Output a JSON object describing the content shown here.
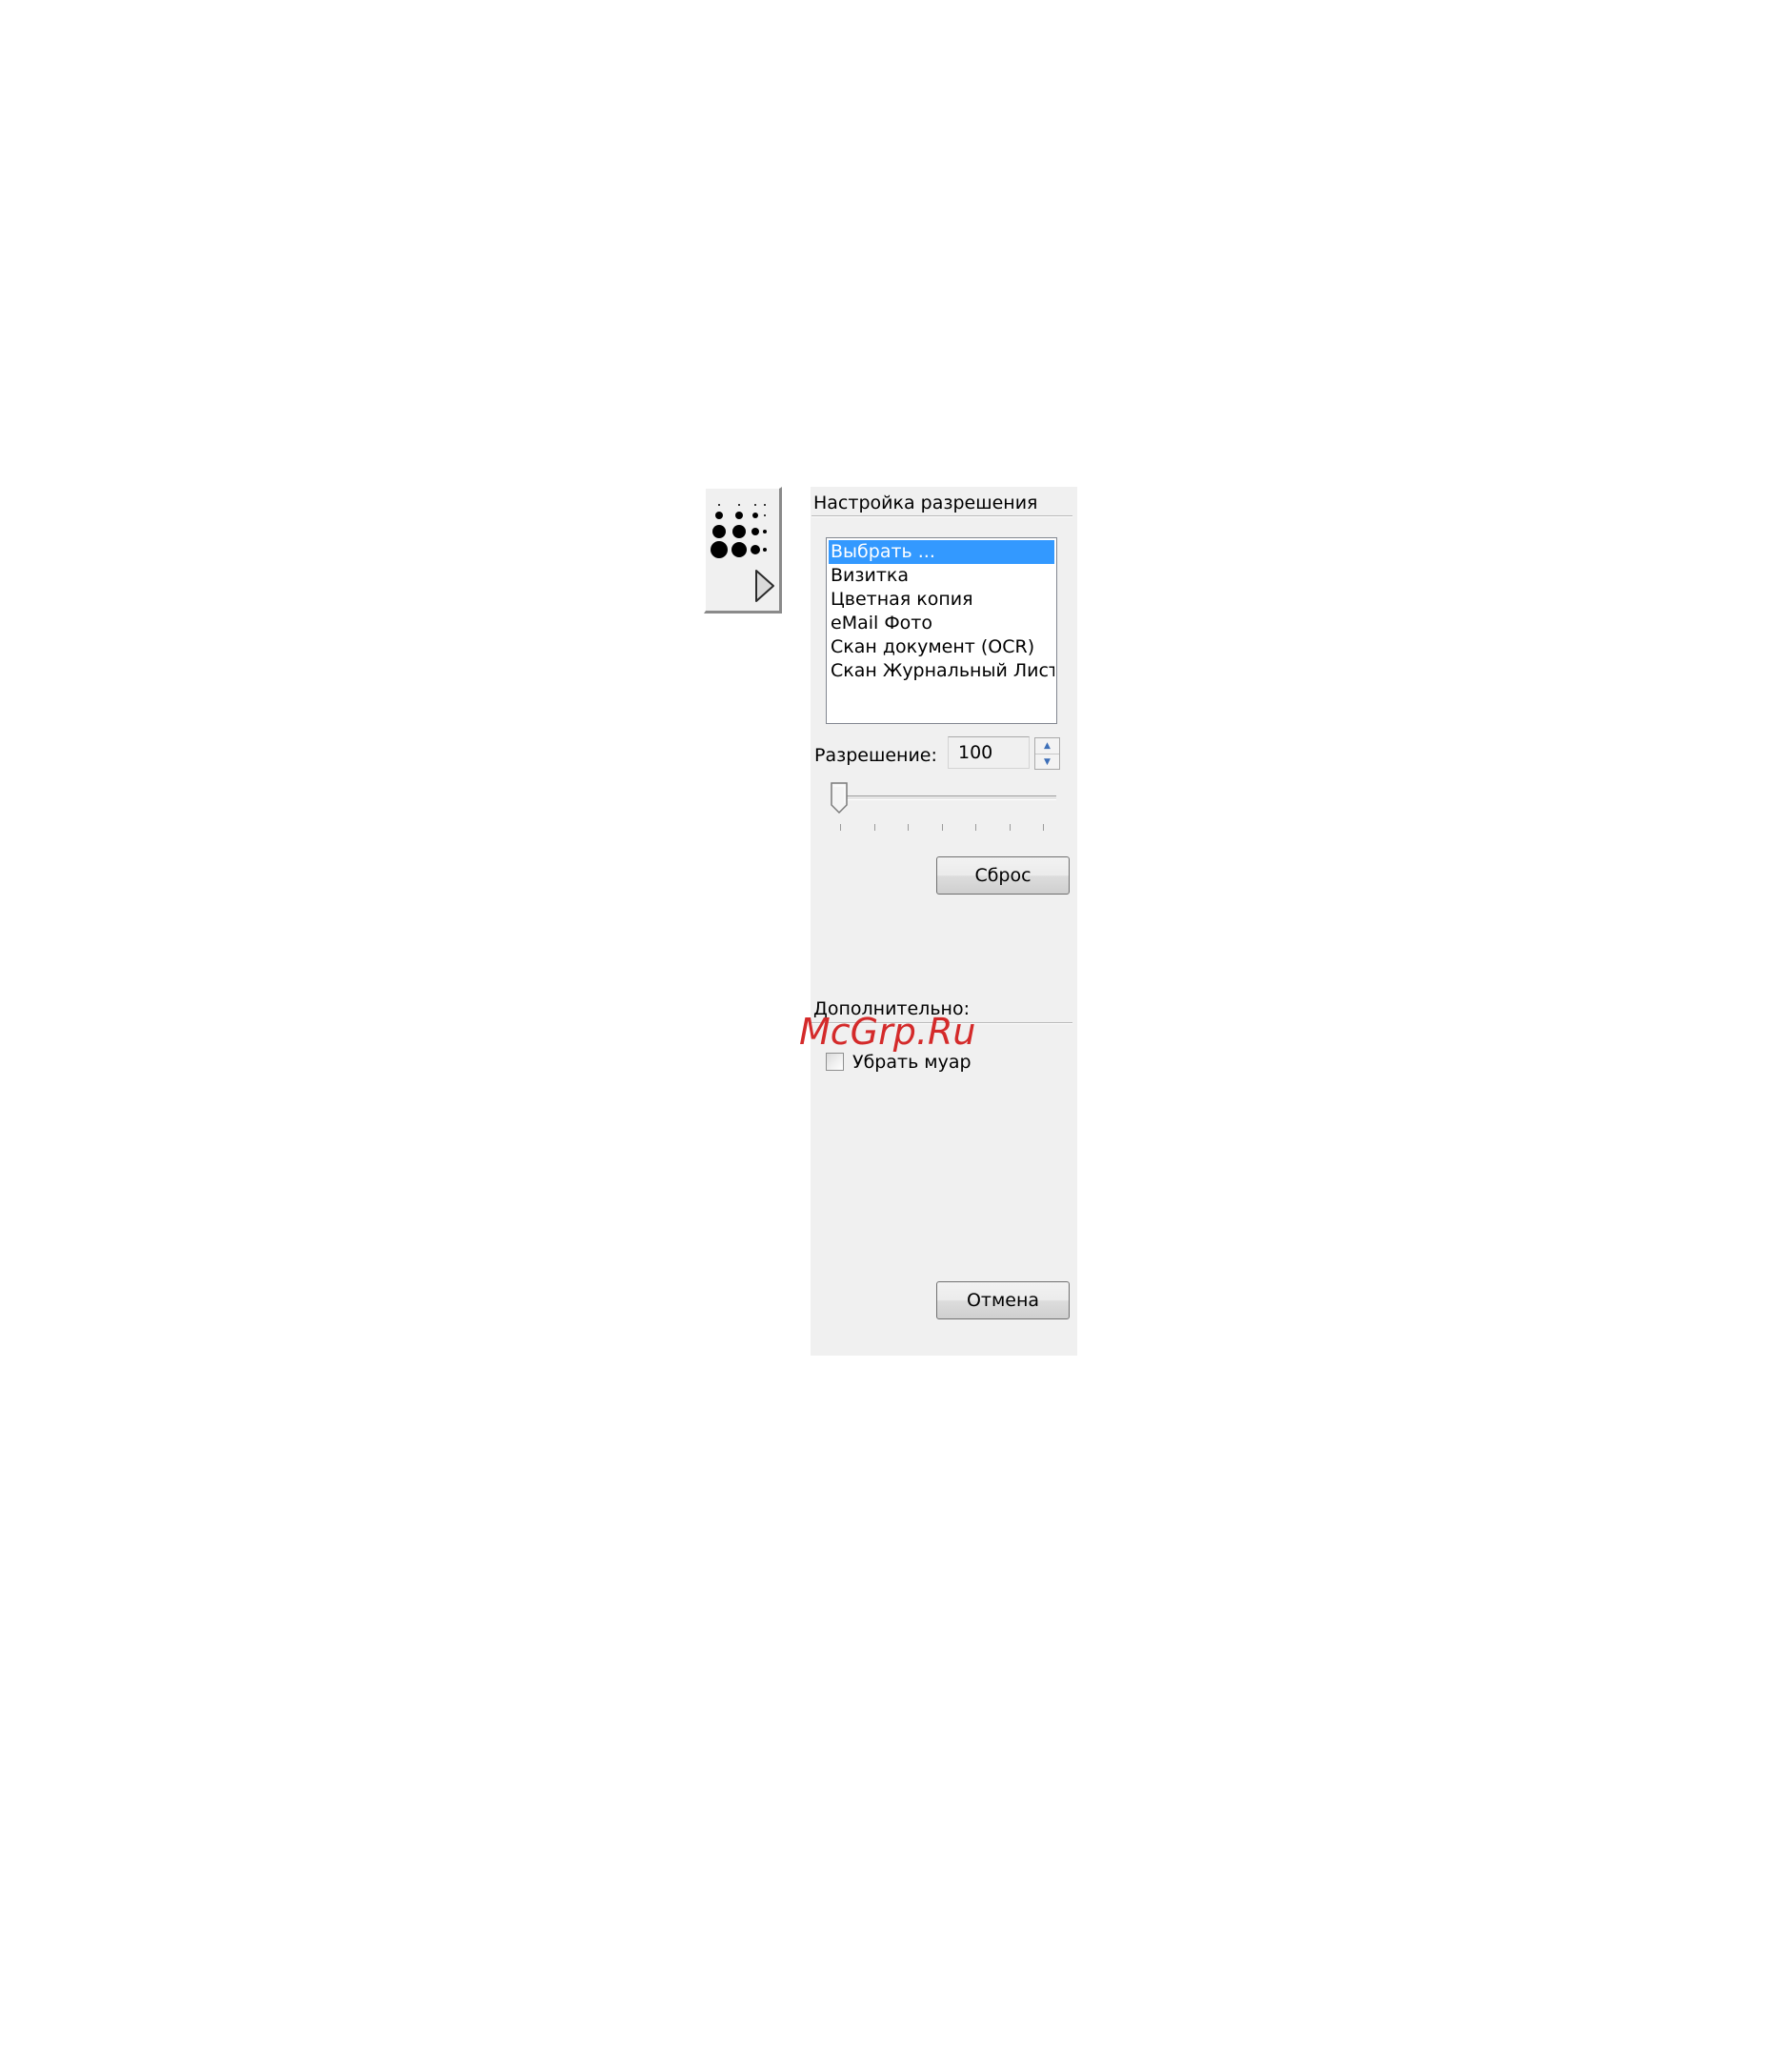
{
  "resolution_tab": {
    "icon": "halftone-dots-icon",
    "arrow_icon": "chevron-right-icon"
  },
  "panel": {
    "title": "Настройка разрешения",
    "presets": {
      "items": [
        "Выбрать ...",
        "Визитка",
        "Цветная копия",
        "eMail Фото",
        "Скан документ (OCR)",
        "Скан Журнальный Лист"
      ],
      "selected_index": 0
    },
    "resolution": {
      "label": "Разрешение:",
      "value": "100",
      "slider_fraction": 0
    },
    "reset_label": "Сброс",
    "advanced": {
      "title": "Дополнительно:",
      "descreen_label": "Убрать муар",
      "descreen_checked": false
    },
    "cancel_label": "Отмена"
  },
  "watermark": "McGrp.Ru",
  "colors": {
    "panel_bg": "#f0f0f0",
    "selection": "#3399ff",
    "watermark": "#d42a2a"
  }
}
